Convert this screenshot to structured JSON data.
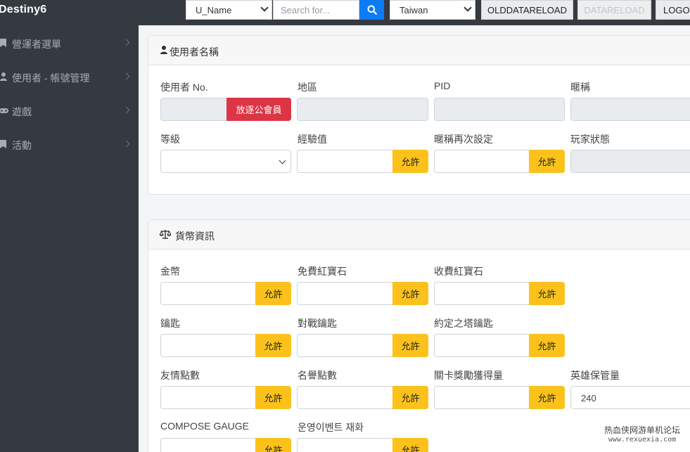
{
  "topbar": {
    "brand": "Destiny6",
    "field_select": "U_Name",
    "search_placeholder": "Search for...",
    "region_select": "Taiwan",
    "olddata_button": "OLDDATARELOAD",
    "datareload_button": "DATARELOAD",
    "logout_button": "LOGOUT"
  },
  "sidebar": {
    "items": [
      {
        "label": "營運者選單",
        "icon": "bookmark-icon"
      },
      {
        "label": "使用者 - 帳號管理",
        "icon": "user-icon"
      },
      {
        "label": "遊戲",
        "icon": "gamepad-icon"
      },
      {
        "label": "活動",
        "icon": "bookmark-icon"
      }
    ]
  },
  "user_card": {
    "title": "使用者名稱",
    "fields": {
      "user_no": {
        "label": "使用者 No.",
        "button": "放逐公會員",
        "value": ""
      },
      "region": {
        "label": "地區",
        "value": ""
      },
      "pid": {
        "label": "PID",
        "value": ""
      },
      "nickname": {
        "label": "暱稱",
        "value": ""
      },
      "level": {
        "label": "等級",
        "value": ""
      },
      "exp": {
        "label": "經驗值",
        "button": "允許",
        "value": ""
      },
      "nick_reset": {
        "label": "暱稱再次設定",
        "button": "允許",
        "value": ""
      },
      "player_status": {
        "label": "玩家狀態",
        "value": ""
      }
    }
  },
  "currency_card": {
    "title": "貨幣資訊",
    "fields": {
      "gold": {
        "label": "金幣",
        "button": "允許",
        "value": ""
      },
      "free_ruby": {
        "label": "免費紅寶石",
        "button": "允許",
        "value": ""
      },
      "paid_ruby": {
        "label": "收費紅寶石",
        "button": "允許",
        "value": ""
      },
      "key": {
        "label": "鑰匙",
        "button": "允許",
        "value": ""
      },
      "battle_key": {
        "label": "對戰鑰匙",
        "button": "允許",
        "value": ""
      },
      "tower_key": {
        "label": "約定之塔鑰匙",
        "button": "允許",
        "value": ""
      },
      "friend_points": {
        "label": "友情點數",
        "button": "允許",
        "value": ""
      },
      "fame_points": {
        "label": "名譽點數",
        "button": "允許",
        "value": ""
      },
      "stage_reward": {
        "label": "關卡獎勵獲得量",
        "button": "允許",
        "value": ""
      },
      "hero_storage": {
        "label": "英雄保管量",
        "value": "240"
      },
      "compose_gauge": {
        "label": "COMPOSE GAUGE",
        "button": "允許",
        "value": ""
      },
      "event_currency": {
        "label": "운영이벤트 재화",
        "button": "允許",
        "value": ""
      }
    }
  },
  "watermark": {
    "line1": "热血侠网游单机论坛",
    "line2": "www.rexuexia.com"
  }
}
